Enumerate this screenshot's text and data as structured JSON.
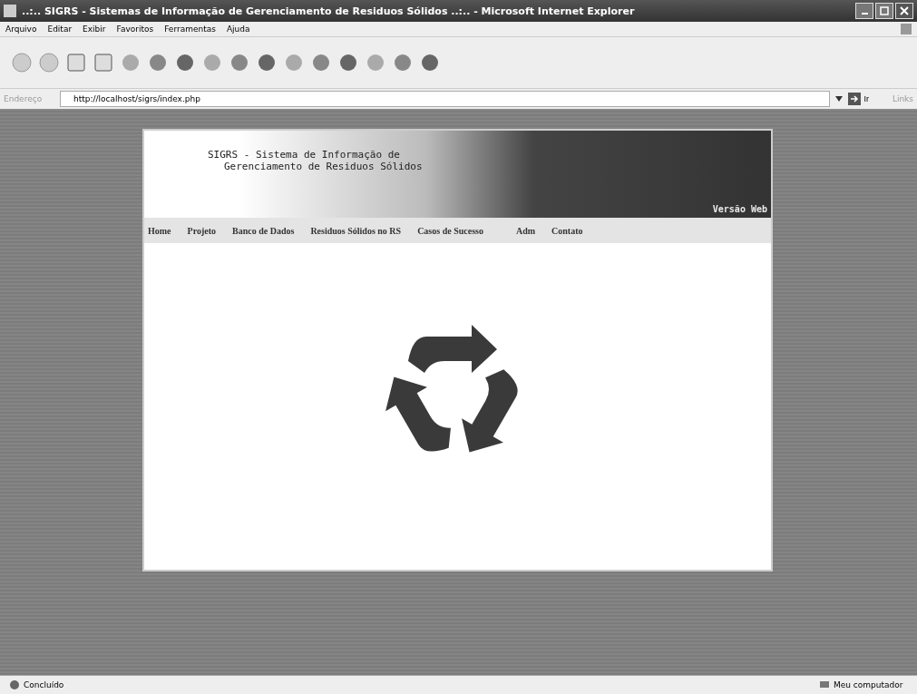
{
  "window": {
    "title": "..:.. SIGRS - Sistemas de Informação de Gerenciamento de Residuos Sólidos ..:.. - Microsoft Internet Explorer"
  },
  "menu": [
    "Arquivo",
    "Editar",
    "Exibir",
    "Favoritos",
    "Ferramentas",
    "Ajuda"
  ],
  "address_bar": {
    "label": "Endereço",
    "value": "http://localhost/sigrs/index.php",
    "go": "Ir",
    "links": "Links"
  },
  "site": {
    "title_lines": [
      "SIGRS - Sistema de Informação de",
      "Gerenciamento de Residuos Sólidos"
    ],
    "version": "Versão Web",
    "nav": [
      "Home",
      "Projeto",
      "Banco de Dados",
      "Residuos Sólidos no RS",
      "Casos de Sucesso",
      "Adm",
      "Contato"
    ]
  },
  "status_bar": {
    "status": "Concluído",
    "zone": "Meu computador"
  }
}
